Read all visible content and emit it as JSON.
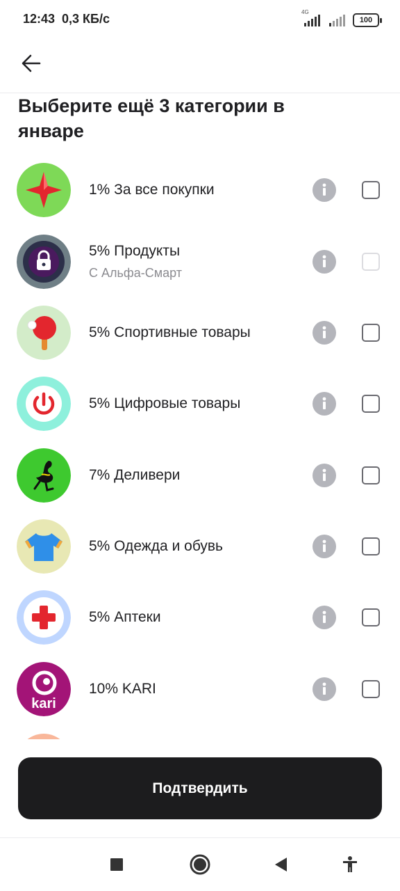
{
  "status_bar": {
    "time": "12:43",
    "speed": "0,3 КБ/с",
    "network_label": "4G",
    "battery": "100"
  },
  "header": {
    "back_icon": "arrow-left-icon"
  },
  "title": "Выберите ещё 3 категории в январе",
  "categories": [
    {
      "label": "1% За все покупки",
      "subtitle": "",
      "icon": "red-star-icon",
      "icon_bg": "#7ed957",
      "checked": false,
      "enabled": true
    },
    {
      "label": "5% Продукты",
      "subtitle": "С Альфа-Смарт",
      "icon": "lock-icon",
      "icon_bg": "#2c2f49",
      "checked": false,
      "enabled": false
    },
    {
      "label": "5% Спортивные товары",
      "subtitle": "",
      "icon": "ping-pong-paddle-icon",
      "icon_bg": "#d3ecc9",
      "checked": false,
      "enabled": true
    },
    {
      "label": "5% Цифровые товары",
      "subtitle": "",
      "icon": "power-button-icon",
      "icon_bg": "#8ef0dc",
      "checked": false,
      "enabled": true
    },
    {
      "label": "7% Деливери",
      "subtitle": "",
      "icon": "ostrich-icon",
      "icon_bg": "#3ec92f",
      "checked": false,
      "enabled": true
    },
    {
      "label": "5% Одежда и обувь",
      "subtitle": "",
      "icon": "t-shirt-icon",
      "icon_bg": "#e8e8b4",
      "checked": false,
      "enabled": true
    },
    {
      "label": "5% Аптеки",
      "subtitle": "",
      "icon": "red-cross-icon",
      "icon_bg": "#bfd6ff",
      "checked": false,
      "enabled": true
    },
    {
      "label": "10% KARI",
      "subtitle": "",
      "icon": "kari-logo-icon",
      "icon_bg": "#a31477",
      "checked": false,
      "enabled": true
    }
  ],
  "kari_logo_text": "kari",
  "confirm_label": "Подтвердить",
  "nav": {
    "recents_icon": "square-icon",
    "home_icon": "circle-icon",
    "back_icon": "triangle-back-icon",
    "accessibility_icon": "accessibility-icon"
  },
  "colors": {
    "button_bg": "#1c1c1e",
    "info_icon": "#b4b5bb",
    "checkbox_border": "#6a6a70"
  }
}
